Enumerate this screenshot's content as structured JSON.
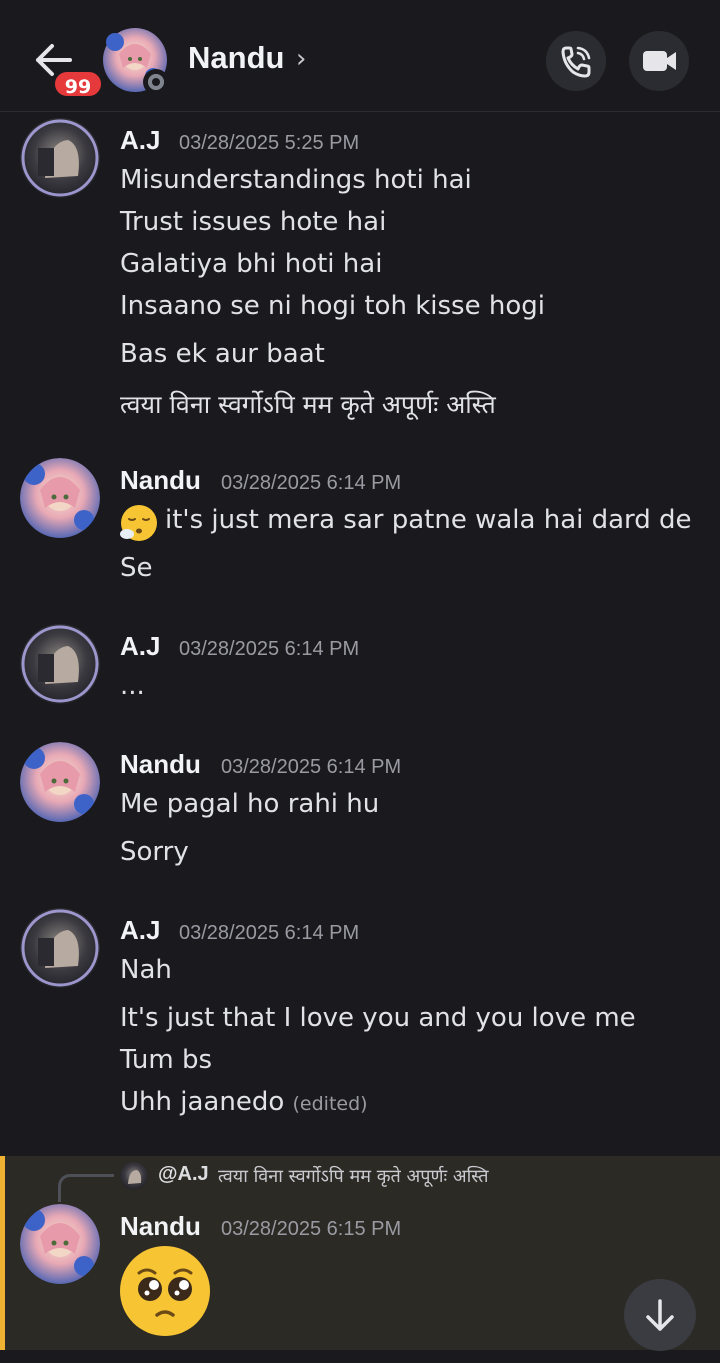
{
  "header": {
    "unread_badge": "99",
    "contact_name": "Nandu",
    "chevron": "›",
    "back_icon": "arrow-left-icon",
    "call_icon": "phone-icon",
    "video_icon": "video-camera-icon"
  },
  "messages": [
    {
      "author": "A.J",
      "timestamp": "03/28/2025 5:25 PM",
      "lines": [
        "Misunderstandings hoti hai",
        "Trust issues hote hai",
        "Galatiya bhi hoti hai",
        "Insaano se ni hogi toh kisse hogi",
        "Bas ek aur baat",
        "त्वया विना स्वर्गोऽपि मम कृते अपूर्णः अस्ति"
      ]
    },
    {
      "author": "Nandu",
      "timestamp": "03/28/2025 6:14 PM",
      "lines": [
        "it's just mera sar patne wala hai dard de",
        "Se"
      ],
      "emoji": "😮‍💨"
    },
    {
      "author": "A.J",
      "timestamp": "03/28/2025 6:14 PM",
      "lines": [
        "..."
      ]
    },
    {
      "author": "Nandu",
      "timestamp": "03/28/2025 6:14 PM",
      "lines": [
        "Me pagal ho rahi hu",
        "Sorry"
      ]
    },
    {
      "author": "A.J",
      "timestamp": "03/28/2025 6:14 PM",
      "lines": [
        "Nah",
        "It's just that I love you and you love me",
        "Tum bs",
        "Uhh jaanedo"
      ],
      "edited_label": "(edited)"
    },
    {
      "author": "Nandu",
      "timestamp": "03/28/2025 6:15 PM",
      "reply_mention": "@A.J",
      "reply_text": "त्वया विना स्वर्गोऽपि मम कृते अपूर्णः अस्ति",
      "emoji": "🥺"
    }
  ],
  "colors": {
    "background": "#1a1a1e",
    "badge": "#e5393c",
    "mention_highlight_bar": "#f0b232",
    "mention_highlight_bg": "#2c2a25"
  },
  "scroll_icon": "arrow-down-icon"
}
